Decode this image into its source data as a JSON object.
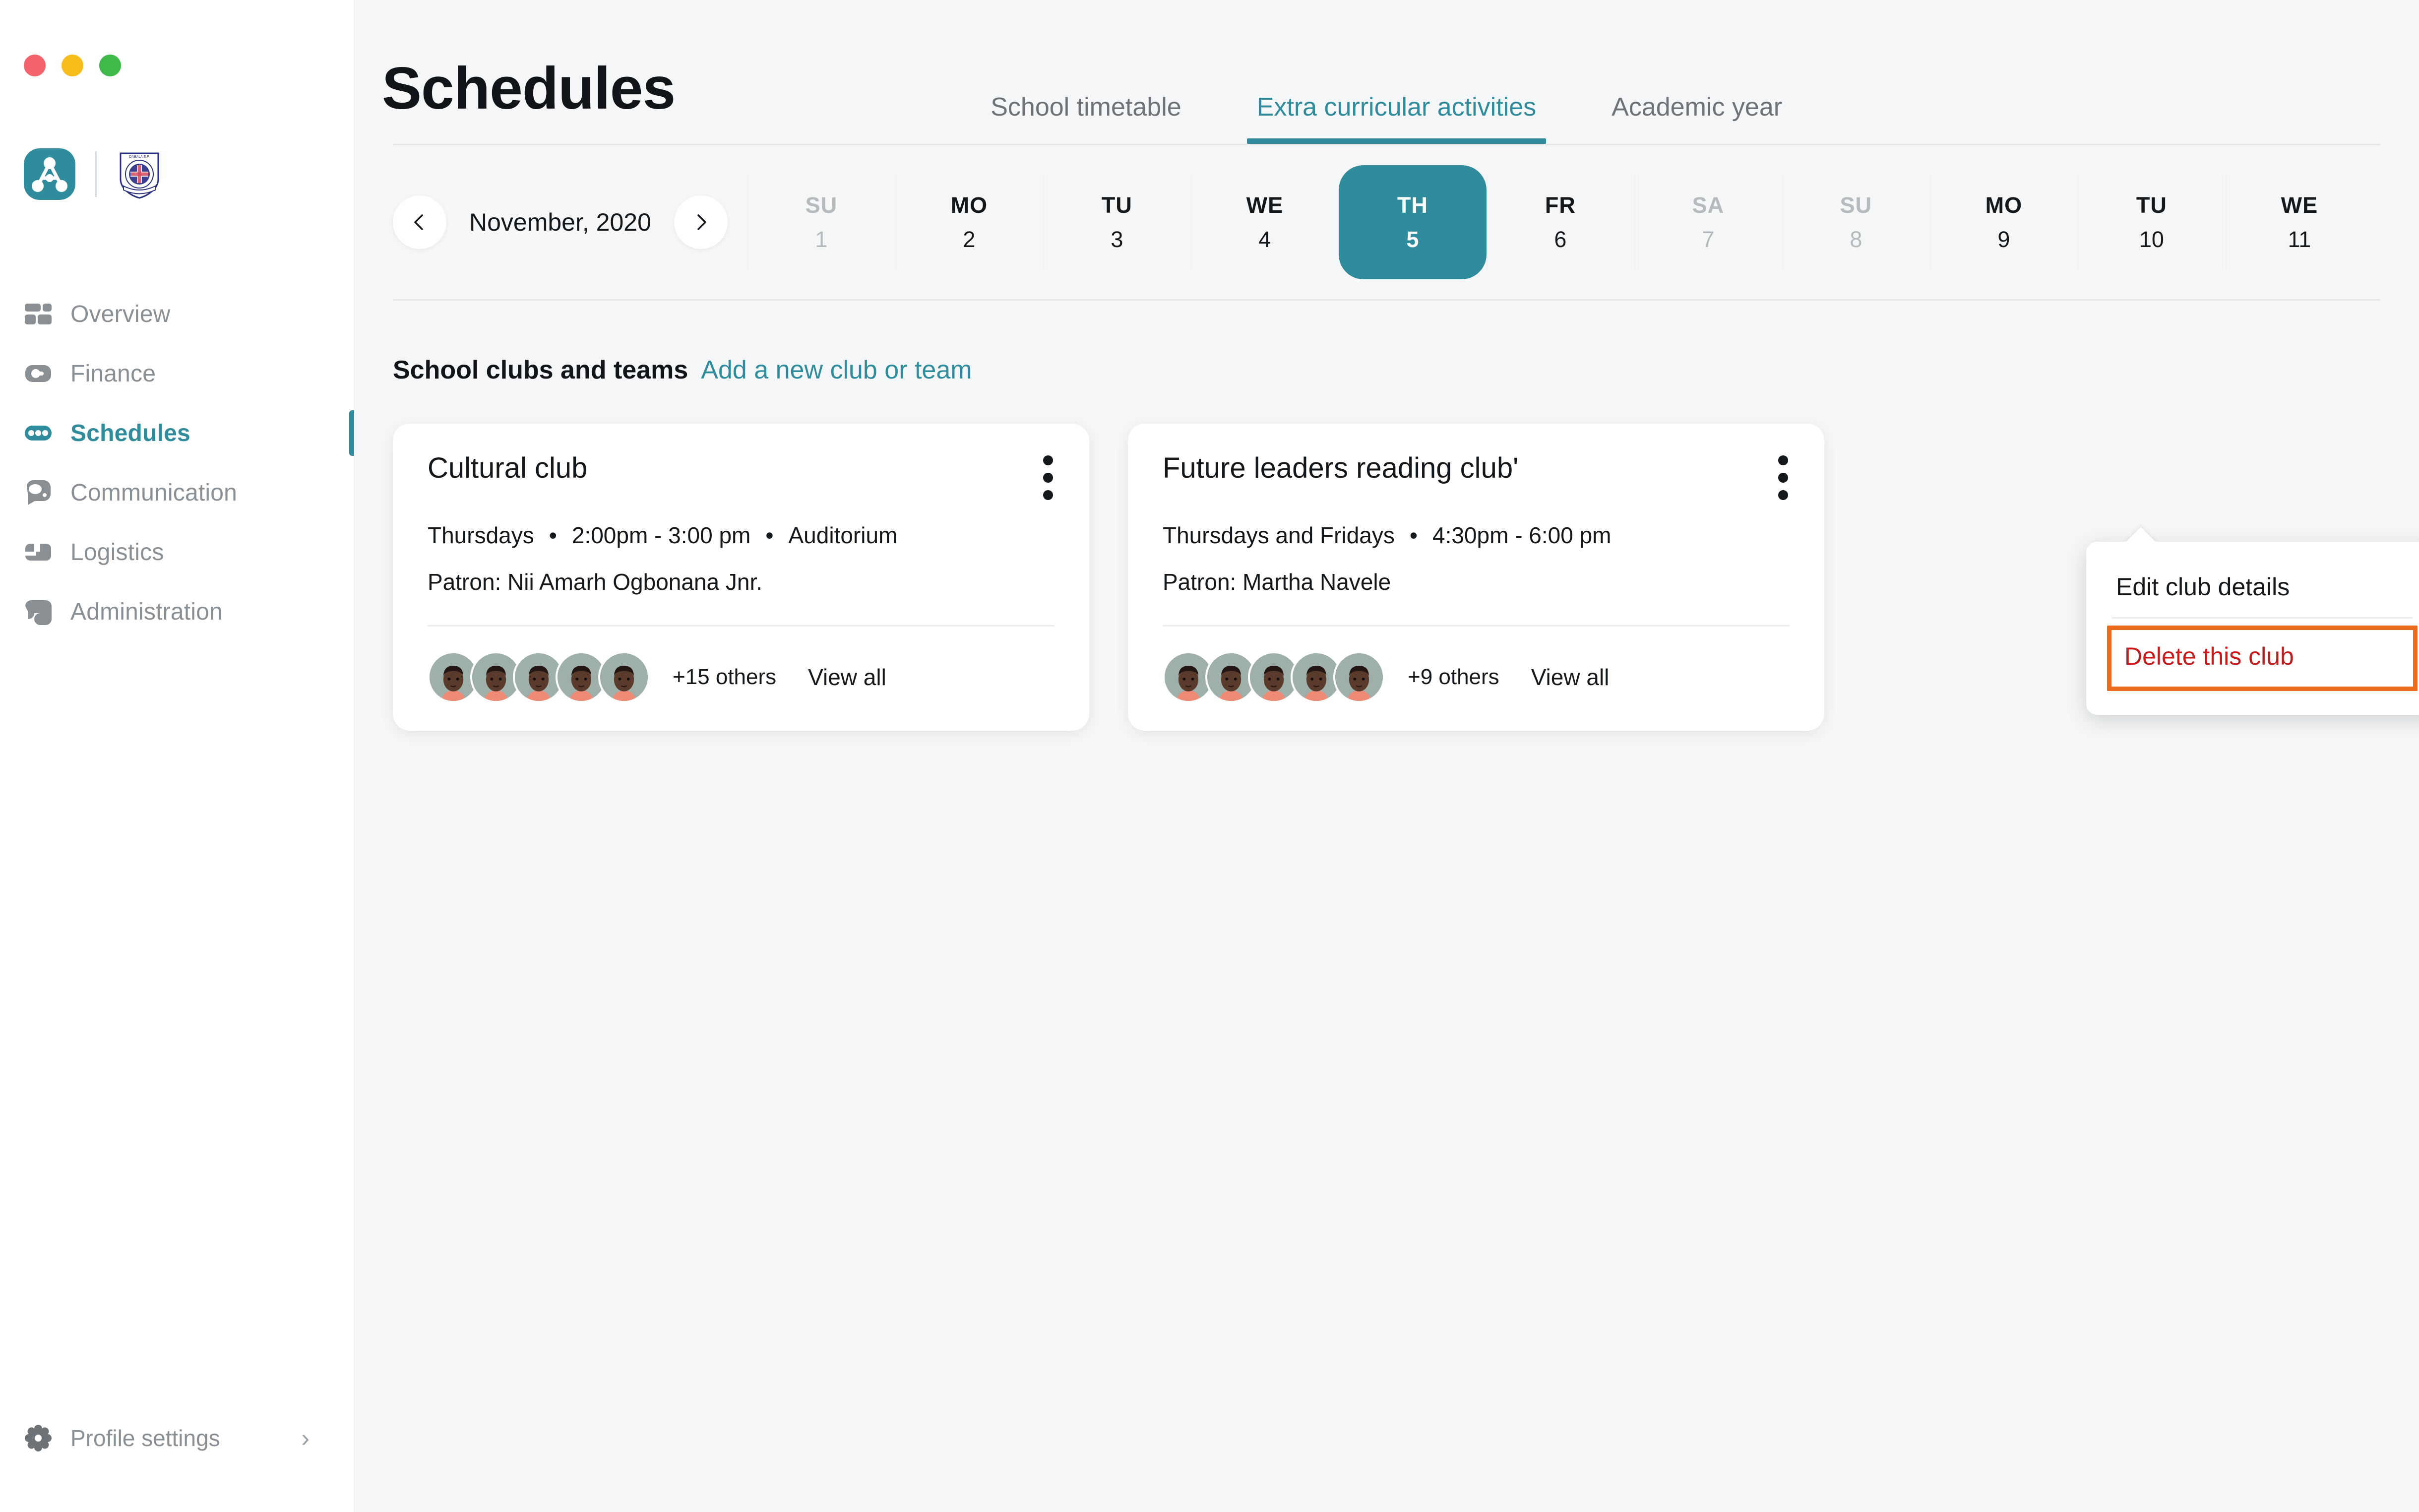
{
  "window": {
    "dots": [
      "close",
      "minimize",
      "maximize"
    ],
    "colors": {
      "close": "#f4636b",
      "minimize": "#f6bd1a",
      "maximize": "#3fb94a"
    }
  },
  "brand": {
    "app_logo_alt": "A",
    "school_crest_text": "DABALA E.P. BASIC 'A' SCHOOL",
    "accent": "#2f8c9c"
  },
  "sidebar": {
    "items": [
      {
        "label": "Overview",
        "icon": "overview-icon",
        "active": false
      },
      {
        "label": "Finance",
        "icon": "finance-icon",
        "active": false
      },
      {
        "label": "Schedules",
        "icon": "schedules-icon",
        "active": true
      },
      {
        "label": "Communication",
        "icon": "communication-icon",
        "active": false
      },
      {
        "label": "Logistics",
        "icon": "logistics-icon",
        "active": false
      },
      {
        "label": "Administration",
        "icon": "administration-icon",
        "active": false
      }
    ],
    "profile": {
      "label": "Profile settings",
      "icon": "gear-icon",
      "chevron": "›"
    }
  },
  "header": {
    "title": "Schedules",
    "tabs": [
      {
        "label": "School timetable",
        "active": false
      },
      {
        "label": "Extra curricular activities",
        "active": true
      },
      {
        "label": "Academic year",
        "active": false
      }
    ]
  },
  "datestrip": {
    "prev_icon": "chevron-left-icon",
    "next_icon": "chevron-right-icon",
    "month": "November, 2020",
    "days": [
      {
        "name": "SU",
        "num": "1",
        "weekend": true,
        "selected": false
      },
      {
        "name": "MO",
        "num": "2",
        "weekend": false,
        "selected": false
      },
      {
        "name": "TU",
        "num": "3",
        "weekend": false,
        "selected": false
      },
      {
        "name": "WE",
        "num": "4",
        "weekend": false,
        "selected": false
      },
      {
        "name": "TH",
        "num": "5",
        "weekend": false,
        "selected": true
      },
      {
        "name": "FR",
        "num": "6",
        "weekend": false,
        "selected": false
      },
      {
        "name": "SA",
        "num": "7",
        "weekend": true,
        "selected": false
      },
      {
        "name": "SU",
        "num": "8",
        "weekend": true,
        "selected": false
      },
      {
        "name": "MO",
        "num": "9",
        "weekend": false,
        "selected": false
      },
      {
        "name": "TU",
        "num": "10",
        "weekend": false,
        "selected": false
      },
      {
        "name": "WE",
        "num": "11",
        "weekend": false,
        "selected": false
      }
    ]
  },
  "section": {
    "title": "School clubs and teams",
    "link": "Add a new club or team"
  },
  "cards": [
    {
      "title": "Cultural club",
      "days": "Thursdays",
      "time": "2:00pm - 3:00 pm",
      "location": "Auditorium",
      "separator": "•",
      "patron": "Patron: Nii Amarh Ogbonana Jnr.",
      "avatar_count": 5,
      "others": "+15 others",
      "view_all": "View all",
      "menu_open": false
    },
    {
      "title": "Future leaders reading clubʹ",
      "days": "Thursdays and Fridays",
      "time": "4:30pm - 6:00 pm",
      "location": "",
      "separator": "•",
      "patron": "Patron: Martha Navele",
      "avatar_count": 5,
      "others": "+9 others",
      "view_all": "View all",
      "menu_open": true
    }
  ],
  "menu": {
    "edit_label": "Edit club details",
    "delete_label": "Delete this club",
    "delete_color": "#c8191b",
    "highlight_color": "#ea6a1e"
  }
}
